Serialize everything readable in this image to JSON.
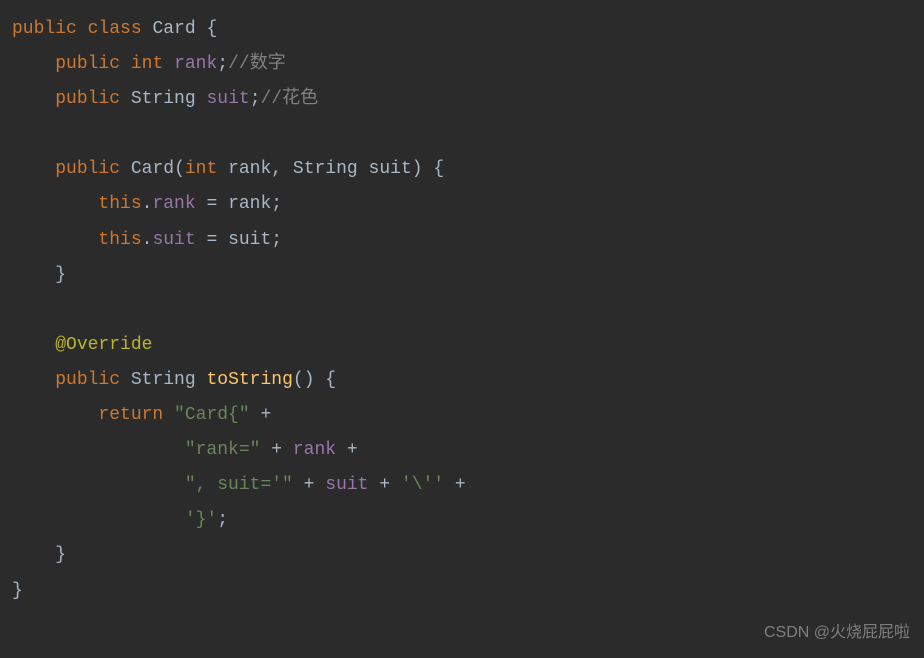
{
  "code": {
    "l1": {
      "kw_public": "public",
      "kw_class": "class",
      "class_name": "Card",
      "brace": " {"
    },
    "l2": {
      "kw_public": "public",
      "type": "int",
      "field": "rank",
      "semi": ";",
      "comment": "//数字"
    },
    "l3": {
      "kw_public": "public",
      "type": "String",
      "field": "suit",
      "semi": ";",
      "comment": "//花色"
    },
    "l5": {
      "kw_public": "public",
      "ctor": "Card",
      "paren_open": "(",
      "p1_type": "int",
      "p1_name": " rank",
      "comma": ", ",
      "p2_type": "String",
      "p2_name": " suit",
      "paren_close": ")",
      "brace": " {"
    },
    "l6": {
      "this": "this",
      "dot": ".",
      "field": "rank",
      "eq": " = ",
      "var": "rank",
      "semi": ";"
    },
    "l7": {
      "this": "this",
      "dot": ".",
      "field": "suit",
      "eq": " = ",
      "var": "suit",
      "semi": ";"
    },
    "l8": {
      "brace": "}"
    },
    "l10": {
      "annotation": "@Override"
    },
    "l11": {
      "kw_public": "public",
      "type": "String",
      "method": "toString",
      "parens": "()",
      "brace": " {"
    },
    "l12": {
      "kw_return": "return",
      "str": "\"Card{\"",
      "plus": " +"
    },
    "l13": {
      "str": "\"rank=\"",
      "plus1": " + ",
      "field": "rank",
      "plus2": " +"
    },
    "l14": {
      "str": "\", suit='\"",
      "plus1": " + ",
      "field": "suit",
      "plus2": " + ",
      "char": "'\\''",
      "plus3": " +"
    },
    "l15": {
      "char": "'}'",
      "semi": ";"
    },
    "l16": {
      "brace": "}"
    },
    "l17": {
      "brace": "}"
    }
  },
  "watermark": "CSDN @火烧屁屁啦"
}
